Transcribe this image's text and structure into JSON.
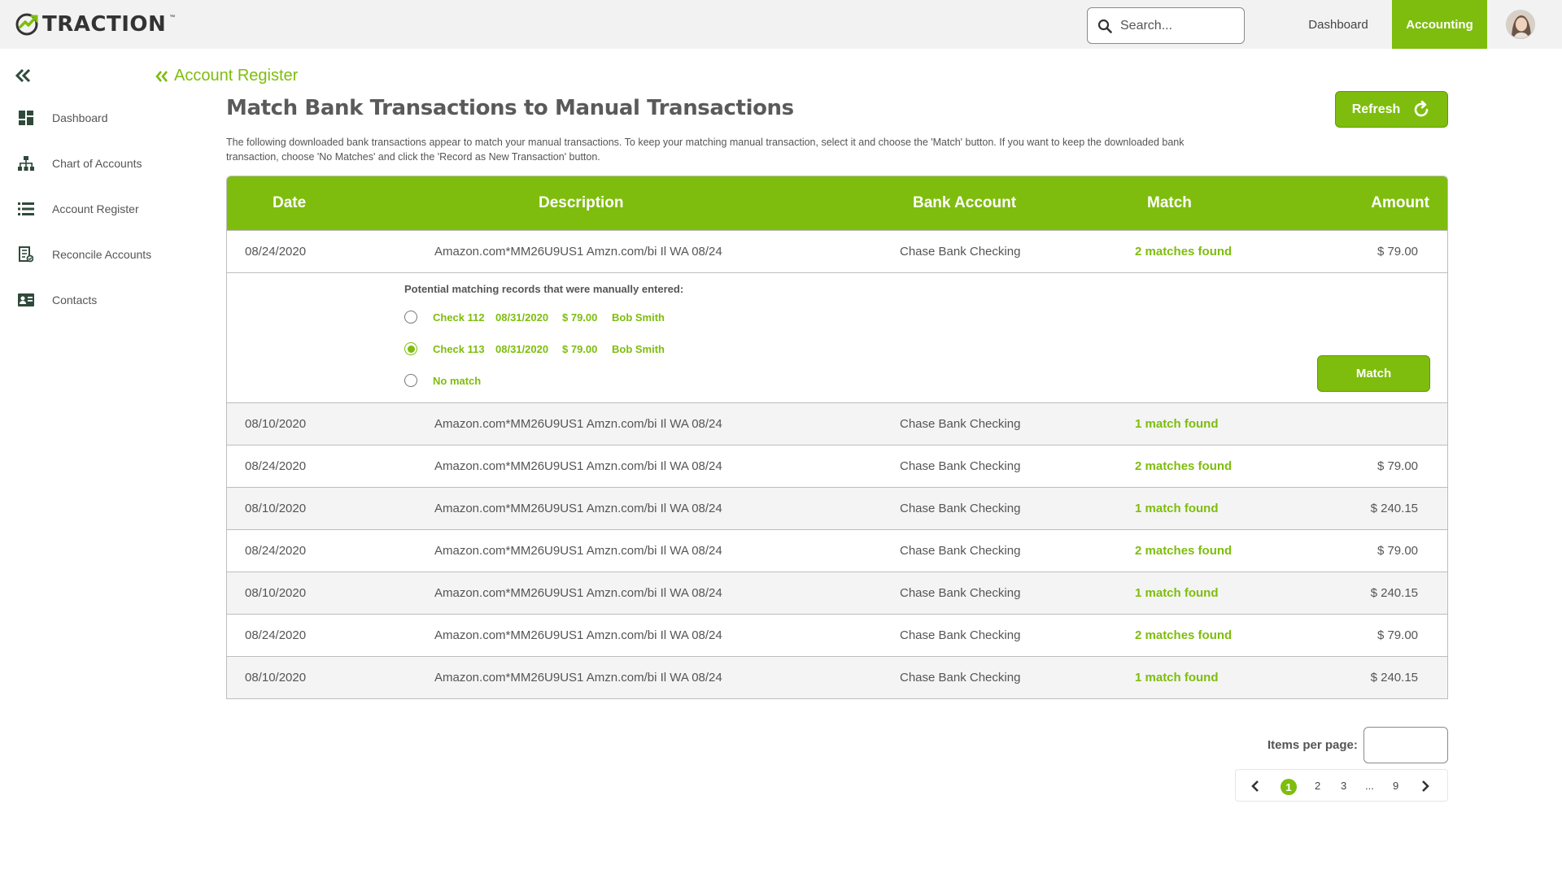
{
  "brand": {
    "name": "TRACTION",
    "tm": "™",
    "color": "#7ebd0d"
  },
  "topnav": {
    "search_placeholder": "Search...",
    "items": [
      {
        "label": "Dashboard",
        "active": false
      },
      {
        "label": "Accounting",
        "active": true
      }
    ]
  },
  "sidebar": {
    "items": [
      {
        "label": "Dashboard",
        "icon": "dashboard-icon"
      },
      {
        "label": "Chart of Accounts",
        "icon": "hierarchy-icon"
      },
      {
        "label": "Account Register",
        "icon": "list-icon"
      },
      {
        "label": "Reconcile Accounts",
        "icon": "reconcile-icon"
      },
      {
        "label": "Contacts",
        "icon": "contact-card-icon"
      }
    ]
  },
  "breadcrumb": {
    "label": "Account Register"
  },
  "page": {
    "title": "Match Bank Transactions to Manual Transactions",
    "refresh_label": "Refresh",
    "intro_line1": "The following downloaded bank transactions appear to match your manual transactions. To keep your matching manual transaction, select it and choose the 'Match' button.  If you want to keep the downloaded bank",
    "intro_line2": "transaction, choose 'No Matches' and click the 'Record as New Transaction' button."
  },
  "table": {
    "headers": {
      "date": "Date",
      "description": "Description",
      "bank": "Bank Account",
      "match": "Match",
      "amount": "Amount"
    },
    "rows": [
      {
        "date": "08/24/2020",
        "description": "Amazon.com*MM26U9US1 Amzn.com/bi Il WA 08/24",
        "bank": "Chase Bank Checking",
        "match": "2 matches found",
        "amount": "$ 79.00"
      },
      {
        "date": "08/10/2020",
        "description": "Amazon.com*MM26U9US1 Amzn.com/bi Il WA 08/24",
        "bank": "Chase Bank Checking",
        "match": "1 match found",
        "amount": ""
      },
      {
        "date": "08/24/2020",
        "description": "Amazon.com*MM26U9US1 Amzn.com/bi Il WA 08/24",
        "bank": "Chase Bank Checking",
        "match": "2 matches found",
        "amount": "$ 79.00"
      },
      {
        "date": "08/10/2020",
        "description": "Amazon.com*MM26U9US1 Amzn.com/bi Il WA 08/24",
        "bank": "Chase Bank Checking",
        "match": "1 match found",
        "amount": "$ 240.15"
      },
      {
        "date": "08/24/2020",
        "description": "Amazon.com*MM26U9US1 Amzn.com/bi Il WA 08/24",
        "bank": "Chase Bank Checking",
        "match": "2 matches found",
        "amount": "$ 79.00"
      },
      {
        "date": "08/10/2020",
        "description": "Amazon.com*MM26U9US1 Amzn.com/bi Il WA 08/24",
        "bank": "Chase Bank Checking",
        "match": "1 match found",
        "amount": "$ 240.15"
      },
      {
        "date": "08/24/2020",
        "description": "Amazon.com*MM26U9US1 Amzn.com/bi Il WA 08/24",
        "bank": "Chase Bank Checking",
        "match": "2 matches found",
        "amount": "$ 79.00"
      },
      {
        "date": "08/10/2020",
        "description": "Amazon.com*MM26U9US1 Amzn.com/bi Il WA 08/24",
        "bank": "Chase Bank Checking",
        "match": "1 match found",
        "amount": "$ 240.15"
      }
    ],
    "expanded": {
      "hint": "Potential matching records that were manually entered:",
      "options": [
        {
          "check": "Check 112",
          "date": "08/31/2020",
          "amount": "$ 79.00",
          "name": "Bob Smith",
          "selected": false
        },
        {
          "check": "Check 113",
          "date": "08/31/2020",
          "amount": "$ 79.00",
          "name": "Bob Smith",
          "selected": true
        },
        {
          "check": "No match",
          "date": "",
          "amount": "",
          "name": "",
          "selected": false
        }
      ],
      "match_label": "Match"
    }
  },
  "pagination": {
    "items_per_page_label": "Items per page:",
    "current": "1",
    "pages": [
      "2",
      "3",
      "...",
      "9"
    ]
  }
}
